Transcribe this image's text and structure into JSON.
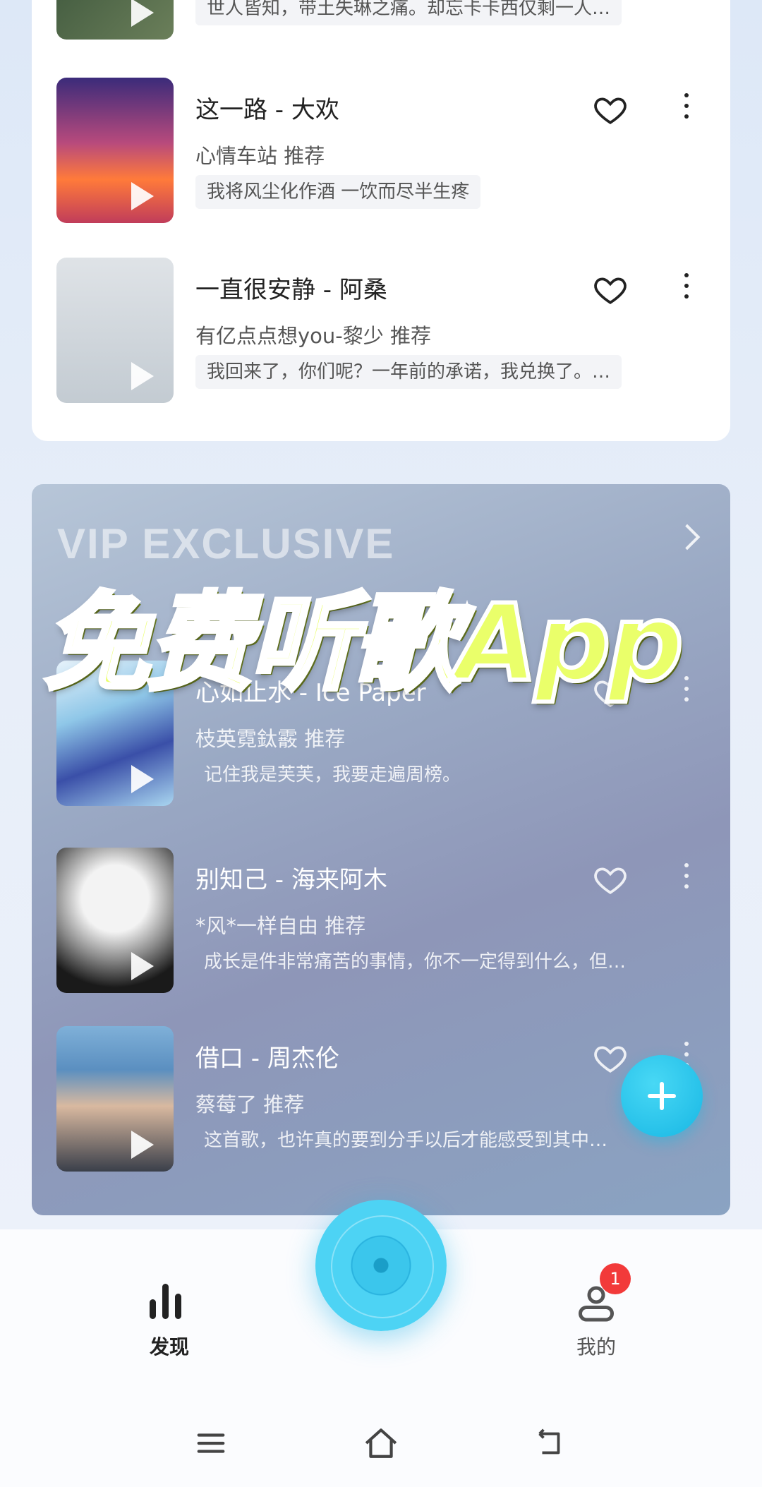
{
  "top_list": [
    {
      "quote": "世人皆知，带土失琳之痛。却忘卡卡西仅剩一人…",
      "colors": [
        "#2f4a33",
        "#6b7f5a"
      ]
    },
    {
      "title": "这一路 - 大欢",
      "sub": "心情车站 推荐",
      "quote": "我将风尘化作酒 一饮而尽半生疼",
      "colors": [
        "#3b2b7a",
        "#b84a7c",
        "#ff7a3a"
      ]
    },
    {
      "title": "一直很安静 - 阿桑",
      "sub": "有亿点点想you-黎少 推荐",
      "quote": "我回来了，你们呢？一年前的承诺，我兑换了。…",
      "colors": [
        "#d8dde2",
        "#b9c2ca"
      ]
    }
  ],
  "vip": {
    "heading": "VIP EXCLUSIVE",
    "songs": [
      {
        "title": "心如止水 - Ice Paper",
        "sub": "枝英霓鈦霰 推荐",
        "quote": "记住我是芙芙，我要走遍周榜。",
        "colors": [
          "#8fc7e8",
          "#3a4fa8",
          "#e8f3fb"
        ]
      },
      {
        "title": "别知己 - 海来阿木",
        "sub": "*风*一样自由 推荐",
        "quote": "成长是件非常痛苦的事情，你不一定得到什么，但…",
        "colors": [
          "#e9e9e9",
          "#8a8a8a",
          "#1a1a1a"
        ]
      },
      {
        "title": "借口 - 周杰伦",
        "sub": "蔡莓了 推荐",
        "quote": "这首歌，也许真的要到分手以后才能感受到其中…",
        "colors": [
          "#3a3f4a",
          "#7fb0d8",
          "#d9b9a0"
        ]
      }
    ]
  },
  "overlay_caption": "免费听歌App",
  "nav": {
    "discover": "发现",
    "me": "我的",
    "badge": "1"
  },
  "colors": {
    "accent": "#18b7e4",
    "badge": "#f23a3a"
  }
}
